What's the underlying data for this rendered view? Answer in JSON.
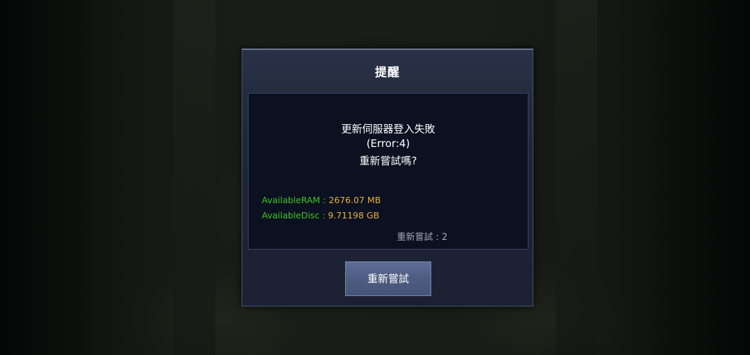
{
  "dialog": {
    "title": "提醒",
    "message_line1": "更新伺服器登入失敗",
    "message_line2": "(Error:4)",
    "message_line3": "重新嘗試嗎?",
    "ram_label": "AvailableRAM : ",
    "ram_value": "2676.07 MB",
    "disc_label": "AvailableDisc : ",
    "disc_value": "9.71198 GB",
    "retry_count": "重新嘗試 : 2",
    "retry_button_label": "重新嘗試"
  },
  "colors": {
    "label_green": "#3ec51f",
    "value_orange": "#e8b03a",
    "dialog_bg": "#1f2538",
    "button_bg": "#56648c"
  }
}
